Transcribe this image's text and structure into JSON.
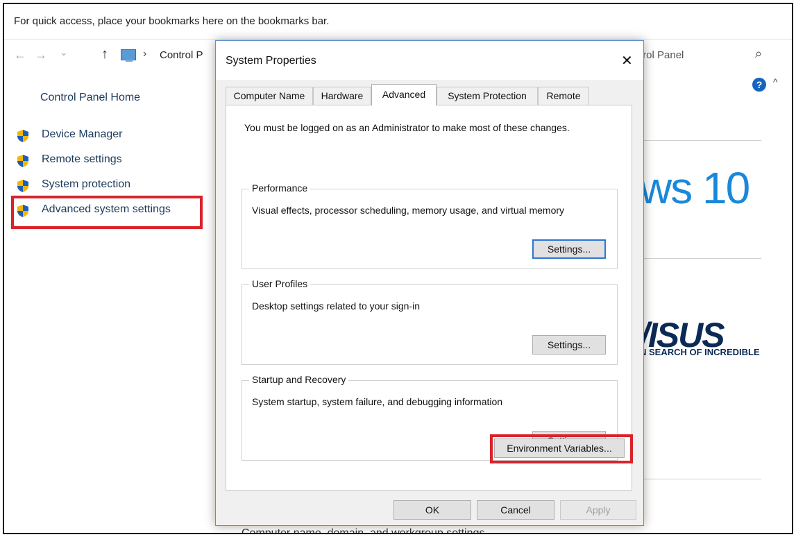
{
  "browser": {
    "bookmarks_hint": "For quick access, place your bookmarks here on the bookmarks bar."
  },
  "explorer": {
    "back_glyph": "←",
    "forward_glyph": "→",
    "dropdown_glyph": "⌄",
    "up_glyph": "↑",
    "breadcrumb_separator": "›",
    "address": "Control P",
    "search_text": "trol Panel",
    "search_icon": "⌕"
  },
  "sidebar": {
    "home": "Control Panel Home",
    "items": [
      {
        "label": "Device Manager",
        "icon": "shield-icon"
      },
      {
        "label": "Remote settings",
        "icon": "shield-icon"
      },
      {
        "label": "System protection",
        "icon": "shield-icon"
      },
      {
        "label": "Advanced system settings",
        "icon": "shield-icon"
      }
    ]
  },
  "main": {
    "help_glyph": "?",
    "scroll_up_glyph": "^",
    "windows_text": "ws 10",
    "asus_logo": "/ISUS",
    "asus_tagline": "N SEARCH OF INCREDIBLE",
    "bottom_text": "Computer name, domain, and workgroup settings"
  },
  "dialog": {
    "title": "System Properties",
    "close_glyph": "✕",
    "tabs": [
      {
        "label": "Computer Name",
        "active": false
      },
      {
        "label": "Hardware",
        "active": false
      },
      {
        "label": "Advanced",
        "active": true
      },
      {
        "label": "System Protection",
        "active": false
      },
      {
        "label": "Remote",
        "active": false
      }
    ],
    "admin_note": "You must be logged on as an Administrator to make most of these changes.",
    "groups": [
      {
        "title": "Performance",
        "description": "Visual effects, processor scheduling, memory usage, and virtual memory",
        "button": "Settings..."
      },
      {
        "title": "User Profiles",
        "description": "Desktop settings related to your sign-in",
        "button": "Settings..."
      },
      {
        "title": "Startup and Recovery",
        "description": "System startup, system failure, and debugging information",
        "button": "Settings..."
      }
    ],
    "env_button": "Environment Variables...",
    "ok": "OK",
    "cancel": "Cancel",
    "apply": "Apply"
  },
  "colors": {
    "highlight": "#d9222a",
    "link": "#1c3a5c",
    "windows_blue": "#1a88d9",
    "asus_navy": "#0b2a55"
  }
}
